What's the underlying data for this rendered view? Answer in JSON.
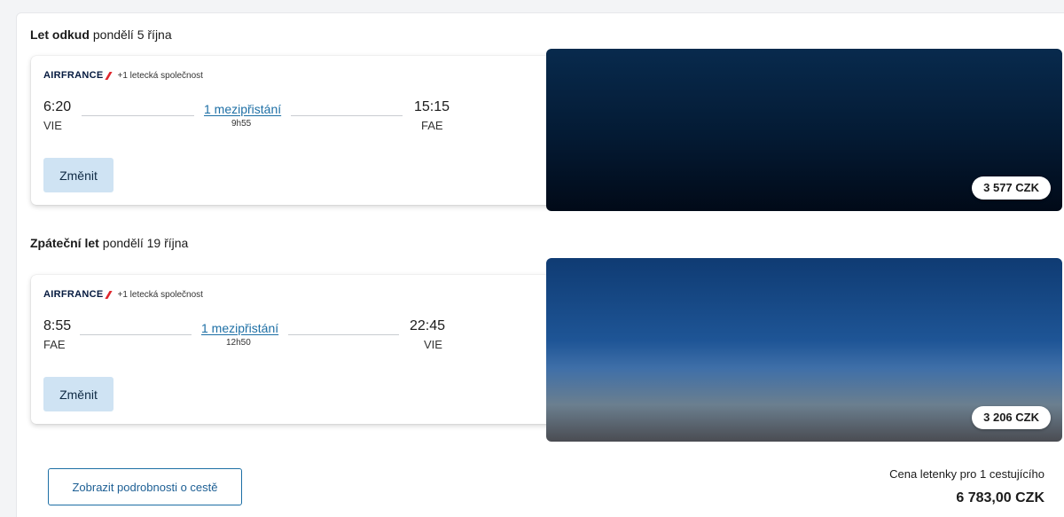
{
  "outbound": {
    "label": "Let odkud",
    "date": "pondělí 5 října",
    "airline": "AIRFRANCE",
    "airline_extra": "+1 letecká společnost",
    "depart_time": "6:20",
    "depart_code": "VIE",
    "arrive_time": "15:15",
    "arrive_code": "FAE",
    "stops": "1 mezipřistání",
    "duration": "9h55",
    "change_label": "Změnit",
    "price": "3 577 CZK"
  },
  "return": {
    "label": "Zpáteční let",
    "date": "pondělí 19 října",
    "airline": "AIRFRANCE",
    "airline_extra": "+1 letecká společnost",
    "depart_time": "8:55",
    "depart_code": "FAE",
    "arrive_time": "22:45",
    "arrive_code": "VIE",
    "stops": "1 mezipřistání",
    "duration": "12h50",
    "change_label": "Změnit",
    "price": "3 206 CZK"
  },
  "footer": {
    "details_button": "Zobrazit podrobnosti o cestě",
    "price_label": "Cena letenky pro 1 cestujícího",
    "total_price": "6 783,00 CZK"
  },
  "colors": {
    "link": "#1d6fa5",
    "change_button_bg": "#cfe3f3",
    "airfrance_red": "#e0262c"
  }
}
